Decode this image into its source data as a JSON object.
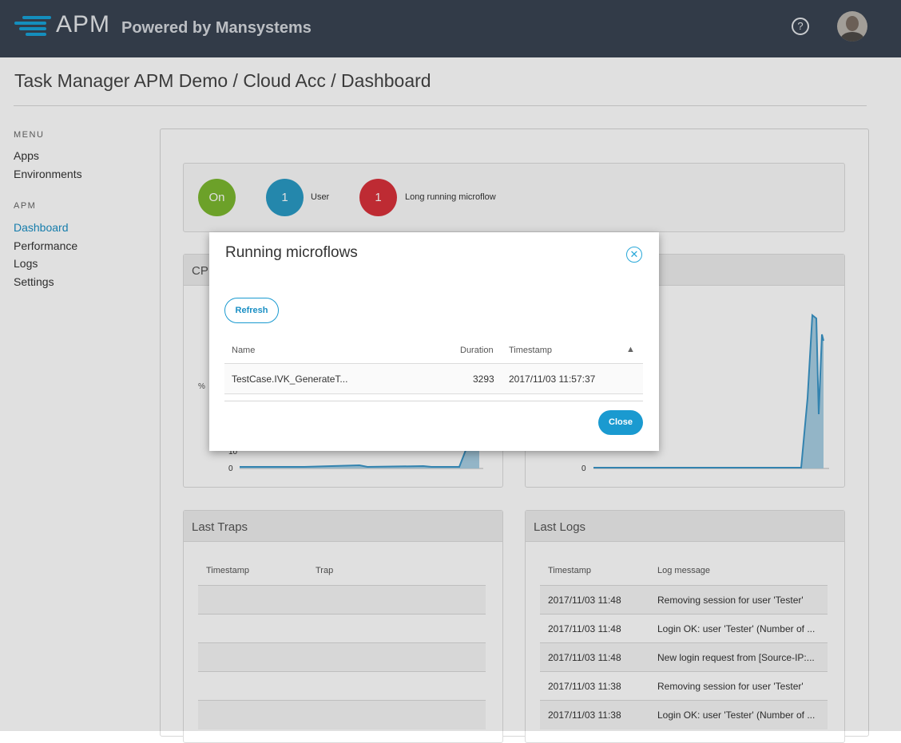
{
  "app": {
    "logo_text": "APM",
    "logo_subtitle": "Powered by Mansystems",
    "help_icon": "question-circle-icon",
    "brand_color": "#17a2d8"
  },
  "breadcrumb": "Task Manager APM Demo / Cloud Acc / Dashboard",
  "sidebar": {
    "menu_heading": "MENU",
    "menu_items": [
      "Apps",
      "Environments"
    ],
    "apm_heading": "APM",
    "apm_items": [
      "Dashboard",
      "Performance",
      "Logs",
      "Settings"
    ],
    "active_item": "Dashboard"
  },
  "status": {
    "on_label": "On",
    "users_count": "1",
    "users_label": "User",
    "long_running_count": "1",
    "long_running_label": "Long running microflow",
    "colors": {
      "on": "#7cb82f",
      "users": "#2a9ac4",
      "long_running": "#d9323b"
    }
  },
  "panels": {
    "cpu_title": "CPU",
    "cpu_chart": {
      "ylabel": "%",
      "ticks": [
        "10",
        "0"
      ]
    },
    "right_chart": {
      "ticks": [
        "0"
      ]
    },
    "traps": {
      "title": "Last Traps",
      "columns": [
        "Timestamp",
        "Trap"
      ]
    },
    "logs": {
      "title": "Last Logs",
      "columns": [
        "Timestamp",
        "Log message"
      ],
      "rows": [
        [
          "2017/11/03 11:48",
          "Removing session for user 'Tester'"
        ],
        [
          "2017/11/03 11:48",
          "Login OK: user 'Tester' (Number of ..."
        ],
        [
          "2017/11/03 11:48",
          "New login request from [Source-IP:..."
        ],
        [
          "2017/11/03 11:38",
          "Removing session for user 'Tester'"
        ],
        [
          "2017/11/03 11:38",
          "Login OK: user 'Tester' (Number of ..."
        ]
      ]
    }
  },
  "modal": {
    "title": "Running microflows",
    "refresh_label": "Refresh",
    "columns": {
      "name": "Name",
      "duration": "Duration",
      "timestamp": "Timestamp",
      "sort_indicator": "▲"
    },
    "rows": [
      {
        "name": "TestCase.IVK_GenerateT...",
        "duration": "3293",
        "timestamp": "2017/11/03 11:57:37"
      }
    ],
    "close_label": "Close"
  }
}
